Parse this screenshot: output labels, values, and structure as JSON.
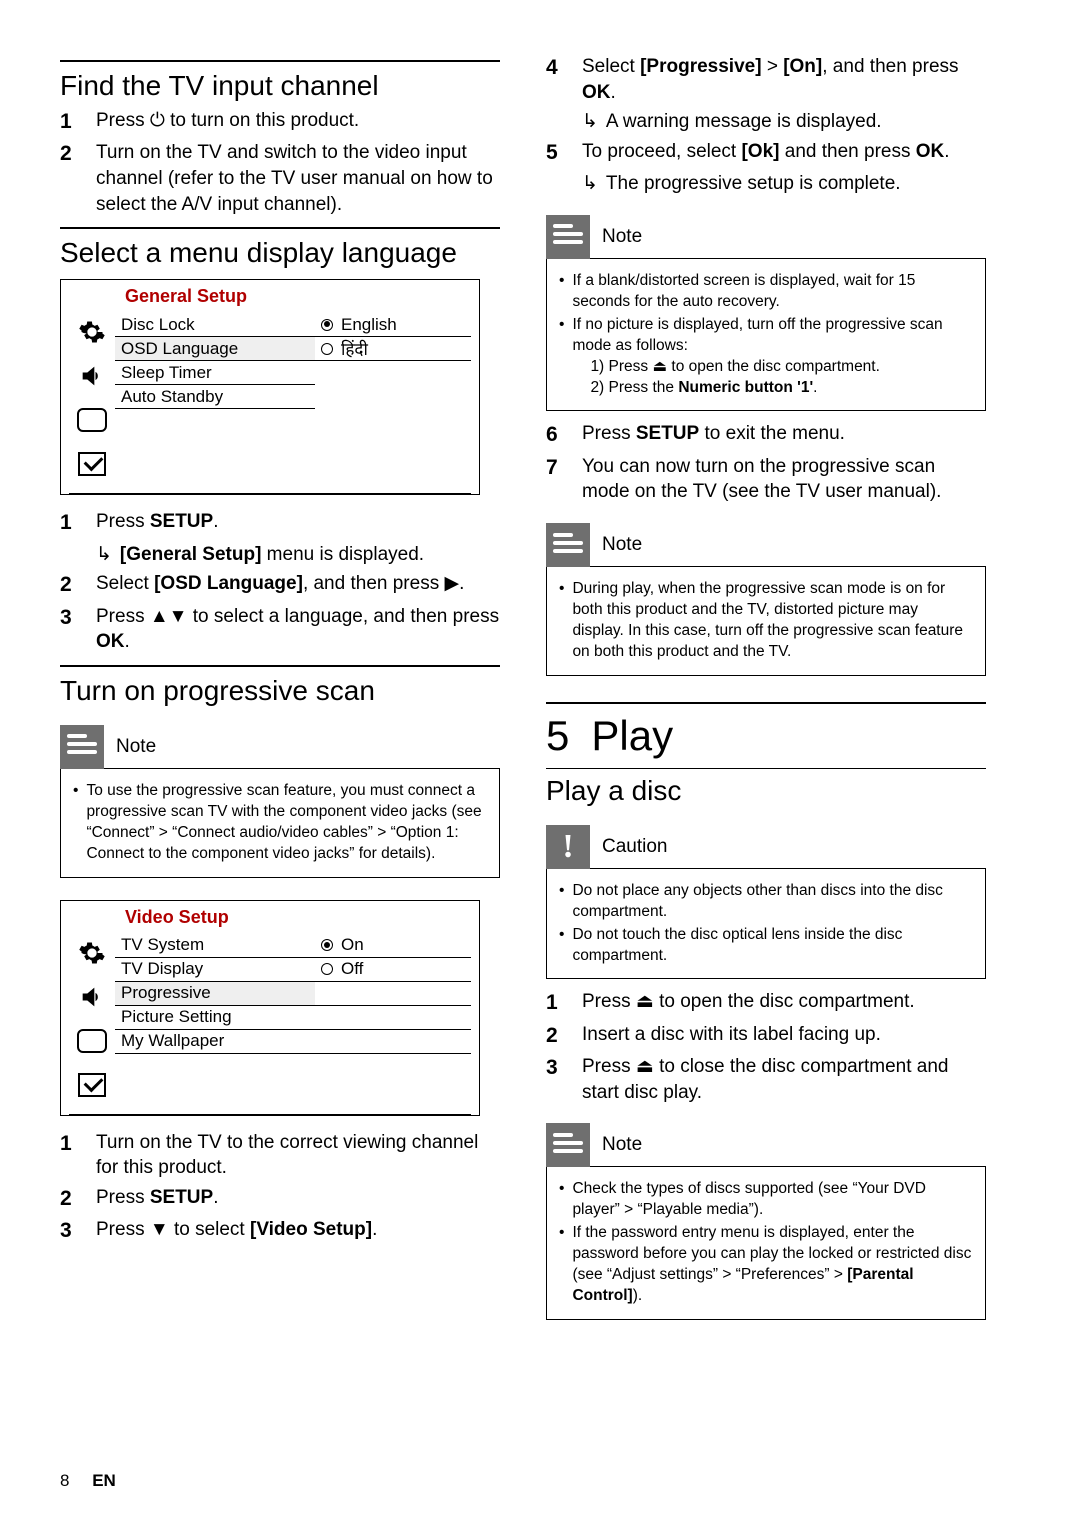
{
  "left": {
    "h_find": "Find the TV input channel",
    "find_steps": [
      "Press ⏻ to turn on this product.",
      "Turn on the TV and switch to the video input channel (refer to the TV user manual on how to select the A/V input channel)."
    ],
    "h_lang": "Select a menu display language",
    "menu1": {
      "title": "General Setup",
      "items": [
        "Disc Lock",
        "OSD Language",
        "Sleep Timer",
        "Auto Standby"
      ],
      "sel_index": 1,
      "vals": [
        "English",
        "हिंदी"
      ]
    },
    "lang_steps": {
      "s1a": "Press ",
      "s1b": "SETUP",
      "s1c": ".",
      "s1_arrow_a": "[General Setup]",
      "s1_arrow_b": " menu is displayed.",
      "s2a": "Select ",
      "s2b": "[OSD Language]",
      "s2c": ", and then press ",
      "s2d": "▶",
      "s2e": ".",
      "s3a": "Press ",
      "s3b": "▲▼",
      "s3c": " to select a language, and then press ",
      "s3d": "OK",
      "s3e": "."
    },
    "h_prog": "Turn on progressive scan",
    "note1_label": "Note",
    "note1_text": "To use the progressive scan feature, you must connect a progressive scan TV with the component video jacks (see “Connect” > “Connect audio/video cables” > “Option 1: Connect to the component video jacks” for details).",
    "menu2": {
      "title": "Video Setup",
      "items": [
        "TV System",
        "TV Display",
        "Progressive",
        "Picture Setting",
        "My Wallpaper"
      ],
      "sel_index": 2,
      "vals": [
        "On",
        "Off"
      ]
    },
    "prog_steps": {
      "s1": "Turn on the TV to the correct viewing channel for this product.",
      "s2a": "Press ",
      "s2b": "SETUP",
      "s2c": ".",
      "s3a": "Press ",
      "s3b": "▼",
      "s3c": " to select ",
      "s3d": "[Video Setup]",
      "s3e": "."
    }
  },
  "right": {
    "s4a": "Select ",
    "s4b": "[Progressive]",
    "s4c": " > ",
    "s4d": "[On]",
    "s4e": ", and then press ",
    "s4f": "OK",
    "s4g": ".",
    "s4_arrow": "A warning message is displayed.",
    "s5a": "To proceed, select ",
    "s5b": "[Ok]",
    "s5c": " and then press ",
    "s5d": "OK",
    "s5e": ".",
    "s5_arrow": "The progressive setup is complete.",
    "note2_label": "Note",
    "note2_b1": "If a blank/distorted screen is displayed, wait for 15 seconds for the auto recovery.",
    "note2_b2": "If no picture is displayed, turn off the progressive scan mode as follows:",
    "note2_sub1a": "1) Press ",
    "note2_sub1b": "⏏",
    "note2_sub1c": " to open the disc compartment.",
    "note2_sub2a": "2) Press the ",
    "note2_sub2b": "Numeric button '1'",
    "note2_sub2c": ".",
    "s6a": "Press ",
    "s6b": "SETUP",
    "s6c": " to exit the menu.",
    "s7": "You can now turn on the progressive scan mode on the TV (see the TV user manual).",
    "note3_label": "Note",
    "note3_text": "During play, when the progressive scan mode is on for both this product and the TV, distorted picture may display. In this case, turn off the progressive scan feature on both this product and the TV.",
    "chapter_num": "5",
    "chapter_title": "Play",
    "h_playdisc": "Play a disc",
    "caution_label": "Caution",
    "caution_b1": "Do not place any objects other than discs into the disc compartment.",
    "caution_b2": "Do not touch the disc optical lens inside the disc compartment.",
    "play_steps": {
      "s1a": "Press ",
      "s1b": "⏏",
      "s1c": " to open the disc compartment.",
      "s2": "Insert a disc with its label facing up.",
      "s3a": "Press ",
      "s3b": "⏏",
      "s3c": " to close the disc compartment and start disc play."
    },
    "note4_label": "Note",
    "note4_b1": "Check the types of discs supported (see “Your DVD player” > “Playable media”).",
    "note4_b2a": "If the password entry menu is displayed, enter the password before you can play the locked or restricted disc (see “Adjust settings” > “Preferences” > ",
    "note4_b2b": "[Parental Control]",
    "note4_b2c": ")."
  },
  "footer": {
    "page": "8",
    "lang": "EN"
  }
}
